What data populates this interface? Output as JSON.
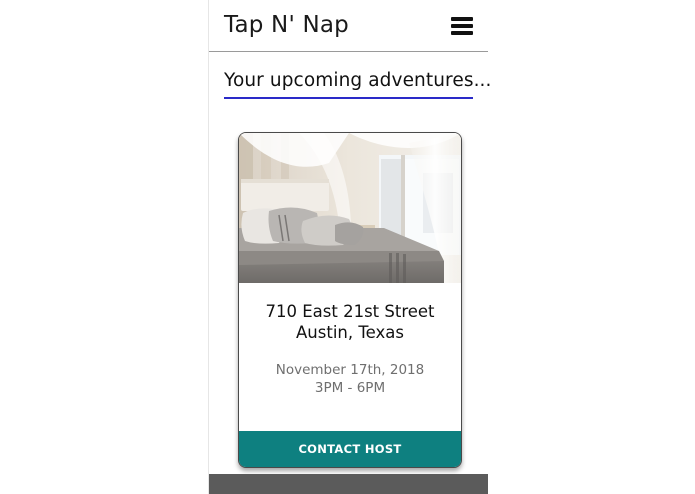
{
  "header": {
    "app_title": "Tap N' Nap",
    "menu_icon": "hamburger-menu-icon"
  },
  "main": {
    "section_title": "Your upcoming adventures..."
  },
  "booking_card": {
    "image": "bedroom-with-canopy-bed-photo",
    "address_line1": "710 East 21st Street",
    "address_line2": "Austin, Texas",
    "date": "November 17th, 2018",
    "time": "3PM - 6PM",
    "contact_label": "CONTACT HOST"
  },
  "colors": {
    "accent_underline": "#2a2ac8",
    "contact_button": "#0e8080",
    "footer": "#5b5b5b"
  }
}
